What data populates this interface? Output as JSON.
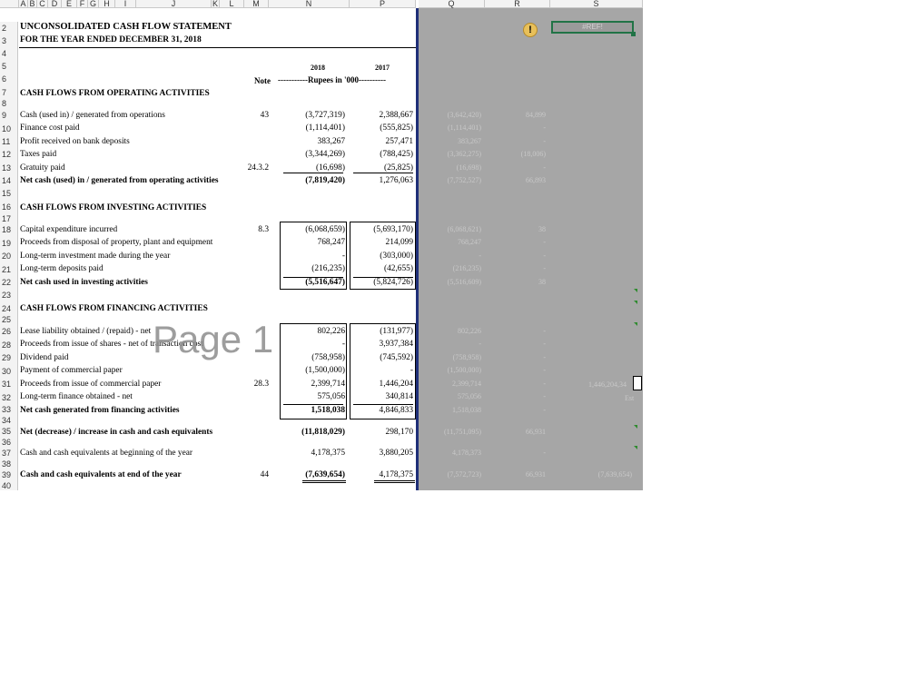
{
  "columns": [
    "A",
    "B",
    "C",
    "D",
    "E",
    "F",
    "G",
    "H",
    "I",
    "J",
    "K",
    "L",
    "M",
    "N",
    "P",
    "Q",
    "R",
    "S"
  ],
  "rows": [
    "2",
    "3",
    "4",
    "5",
    "6",
    "7",
    "8",
    "9",
    "10",
    "11",
    "12",
    "13",
    "14",
    "15",
    "16",
    "17",
    "18",
    "19",
    "20",
    "21",
    "22",
    "23",
    "24",
    "25",
    "26",
    "28",
    "29",
    "30",
    "31",
    "32",
    "33",
    "34",
    "35",
    "36",
    "37",
    "38",
    "39",
    "40"
  ],
  "title": "UNCONSOLIDATED CASH FLOW STATEMENT",
  "subtitle": "FOR THE YEAR ENDED DECEMBER 31, 2018",
  "header": {
    "year1": "2018",
    "year2": "2017",
    "note": "Note",
    "units": "-----------Rupees in '000----------"
  },
  "sections": {
    "operating": "CASH FLOWS FROM OPERATING ACTIVITIES",
    "investing": "CASH FLOWS FROM INVESTING ACTIVITIES",
    "financing": "CASH FLOWS FROM FINANCING ACTIVITIES"
  },
  "lines": [
    {
      "label": "Cash (used in) / generated from operations",
      "note": "43",
      "v2018": "(3,727,319)",
      "v2017": "2,388,667",
      "q": "(3,642,420)",
      "r": "84,899",
      "bold": false
    },
    {
      "label": "Finance cost paid",
      "note": "",
      "v2018": "(1,114,401)",
      "v2017": "(555,825)",
      "q": "(1,114,401)",
      "r": "-",
      "bold": false
    },
    {
      "label": "Profit received on bank deposits",
      "note": "",
      "v2018": "383,267",
      "v2017": "257,471",
      "q": "383,267",
      "r": "-",
      "bold": false
    },
    {
      "label": "Taxes paid",
      "note": "",
      "v2018": "(3,344,269)",
      "v2017": "(788,425)",
      "q": "(3,362,275)",
      "r": "(18,006)",
      "bold": false
    },
    {
      "label": "Gratuity paid",
      "note": "24.3.2",
      "v2018": "(16,698)",
      "v2017": "(25,825)",
      "q": "(16,698)",
      "r": "-",
      "bold": false
    },
    {
      "label": "Net cash (used) in / generated from operating activities",
      "note": "",
      "v2018": "(7,819,420)",
      "v2017": "1,276,063",
      "q": "(7,752,527)",
      "r": "66,893",
      "bold": true
    },
    {
      "label": "Capital expenditure incurred",
      "note": "8.3",
      "v2018": "(6,068,659)",
      "v2017": "(5,693,170)",
      "q": "(6,068,621)",
      "r": "38",
      "bold": false
    },
    {
      "label": "Proceeds from disposal of property, plant and equipment",
      "note": "",
      "v2018": "768,247",
      "v2017": "214,099",
      "q": "768,247",
      "r": "-",
      "bold": false
    },
    {
      "label": "Long-term investment made during the year",
      "note": "",
      "v2018": "-",
      "v2017": "(303,000)",
      "q": "-",
      "r": "-",
      "bold": false
    },
    {
      "label": "Long-term deposits paid",
      "note": "",
      "v2018": "(216,235)",
      "v2017": "(42,655)",
      "q": "(216,235)",
      "r": "-",
      "bold": false
    },
    {
      "label": "Net cash used in investing activities",
      "note": "",
      "v2018": "(5,516,647)",
      "v2017": "(5,824,726)",
      "q": "(5,516,609)",
      "r": "38",
      "bold": true
    },
    {
      "label": "Lease liability obtained / (repaid) - net",
      "note": "",
      "v2018": "802,226",
      "v2017": "(131,977)",
      "q": "802,226",
      "r": "-",
      "bold": false
    },
    {
      "label": "Proceeds from issue of shares - net of transaction cost",
      "note": "",
      "v2018": "-",
      "v2017": "3,937,384",
      "q": "-",
      "r": "-",
      "bold": false
    },
    {
      "label": "Dividend paid",
      "note": "",
      "v2018": "(758,958)",
      "v2017": "(745,592)",
      "q": "(758,958)",
      "r": "-",
      "bold": false
    },
    {
      "label": "Payment of commercial paper",
      "note": "",
      "v2018": "(1,500,000)",
      "v2017": "-",
      "q": "(1,500,000)",
      "r": "-",
      "bold": false
    },
    {
      "label": "Proceeds from issue of commercial paper",
      "note": "28.3",
      "v2018": "2,399,714",
      "v2017": "1,446,204",
      "q": "2,399,714",
      "r": "-",
      "bold": false
    },
    {
      "label": "Long-term finance obtained - net",
      "note": "",
      "v2018": "575,056",
      "v2017": "340,814",
      "q": "575,056",
      "r": "-",
      "bold": false
    },
    {
      "label": "Net cash generated from financing activities",
      "note": "",
      "v2018": "1,518,038",
      "v2017": "4,846,833",
      "q": "1,518,038",
      "r": "-",
      "bold": true
    },
    {
      "label": "Net (decrease) / increase in cash and cash equivalents",
      "note": "",
      "v2018": "(11,818,029)",
      "v2017": "298,170",
      "q": "(11,751,095)",
      "r": "66,931",
      "bold": true
    },
    {
      "label": "Cash and cash equivalents at beginning of the year",
      "note": "",
      "v2018": "4,178,375",
      "v2017": "3,880,205",
      "q": "4,178,373",
      "r": "-",
      "bold": false
    },
    {
      "label": "Cash and cash equivalents at end of the year",
      "note": "44",
      "v2018": "(7,639,654)",
      "v2017": "4,178,375",
      "q": "(7,572,723)",
      "r": "66,931",
      "bold": true
    }
  ],
  "extra": {
    "s31": "1,446,204,34",
    "s31b": "Est",
    "s39": "(7,639,654)",
    "selected_cell_value": "#REF!"
  },
  "watermark": "Page 1",
  "warning_symbol": "!"
}
